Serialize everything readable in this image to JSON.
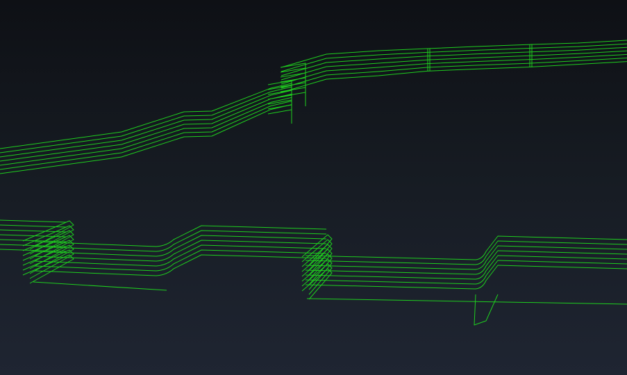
{
  "scene": {
    "wire_color": "#1fd01f",
    "background_top": "#0e1015",
    "background_bottom": "#1f2532",
    "upper_layers": 7,
    "lower_layers": 7
  }
}
